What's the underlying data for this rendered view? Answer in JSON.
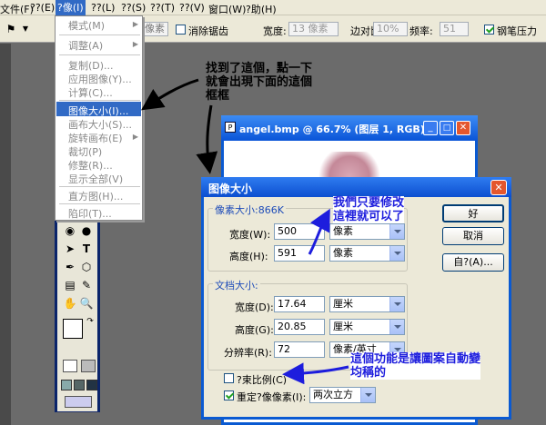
{
  "menubar": {
    "items": [
      "文件(F)",
      "??(E)",
      "?像(I)",
      "??(L)",
      "??(S)",
      "??(T)",
      "??(V)",
      "窗口(W)",
      "?助(H)"
    ]
  },
  "options": {
    "field1": "像素",
    "antialias_label": "消除锯齿",
    "width_label": "宽度:",
    "width_value": "13 像素",
    "edge_label": "边对比度:",
    "edge_value": "10%",
    "freq_label": "频率:",
    "freq_value": "51",
    "pen_label": "钢笔压力"
  },
  "menu": {
    "items": [
      {
        "label": "模式(M)",
        "submenu": true
      },
      {
        "label": "调整(A)",
        "submenu": true
      },
      {
        "label": "复制(D)..."
      },
      {
        "label": "应用图像(Y)..."
      },
      {
        "label": "计算(C)..."
      },
      {
        "label": "图像大小(I)...",
        "highlighted": true
      },
      {
        "label": "画布大小(S)..."
      },
      {
        "label": "旋转画布(E)",
        "submenu": true
      },
      {
        "label": "裁切(P)"
      },
      {
        "label": "修整(R)..."
      },
      {
        "label": "显示全部(V)"
      },
      {
        "label": "直方图(H)..."
      },
      {
        "label": "陷印(T)..."
      }
    ]
  },
  "canvas_window": {
    "title": "angel.bmp @ 66.7% (图层 1, RGB)"
  },
  "dialog": {
    "title": "图像大小",
    "pixel_group_label": "像素大小:866K",
    "px_width_label": "宽度(W):",
    "px_width_value": "500",
    "px_height_label": "高度(H):",
    "px_height_value": "591",
    "px_unit": "像素",
    "doc_group_label": "文档大小:",
    "doc_width_label": "宽度(D):",
    "doc_width_value": "17.64",
    "doc_height_label": "高度(G):",
    "doc_height_value": "20.85",
    "doc_unit": "厘米",
    "res_label": "分辨率(R):",
    "res_value": "72",
    "res_unit": "像素/英寸",
    "constrain_label": "?束比例(C)",
    "resample_label": "重定?像像素(I):",
    "resample_value": "两次立方",
    "ok_label": "好",
    "cancel_label": "取消",
    "auto_label": "自?(A)..."
  },
  "annotations": {
    "note1_line1": "找到了這個，點一下",
    "note1_line2": "就會出現下面的這個",
    "note1_line3": "框框",
    "note2_line1": "我們只要修改",
    "note2_line2": "這裡就可以了",
    "note3_line1": "這個功能是讓圖案自動變",
    "note3_line2": "均稱的"
  },
  "colors": {
    "highlight": "#316ac5",
    "titlebar": "#0a54d8",
    "annotation_text": "#1d1ddd"
  }
}
